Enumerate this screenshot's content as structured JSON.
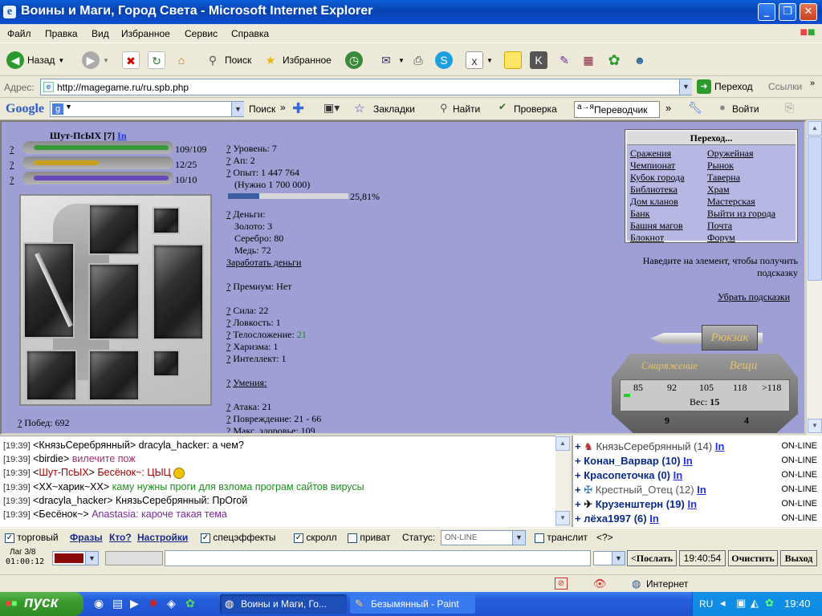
{
  "window": {
    "title": "Воины и Маги, Город Света - Microsoft Internet Explorer",
    "ie_glyph": "e"
  },
  "menu": [
    "Файл",
    "Правка",
    "Вид",
    "Избранное",
    "Сервис",
    "Справка"
  ],
  "toolbar": {
    "back": "Назад",
    "search": "Поиск",
    "favorites": "Избранное"
  },
  "address": {
    "label": "Адрес:",
    "url": "http://magegame.ru/ru.spb.php",
    "go": "Переход",
    "links": "Ссылки"
  },
  "googlebar": {
    "logo": "Google",
    "search": "Поиск",
    "bookmarks": "Закладки",
    "find": "Найти",
    "check": "Проверка",
    "translate": "Переводчик",
    "login": "Войти"
  },
  "character": {
    "name": "Шут-ПсЫХ [7]",
    "info_tag": "In",
    "hp": "109/109",
    "hp_fill": 1.0,
    "mana": "12/25",
    "mana_fill": 0.48,
    "energy": "10/10",
    "energy_fill": 1.0,
    "wins": "Побед: 692",
    "level": "Уровень: 7",
    "ap": "Ап: 2",
    "exp": "Опыт: 1 447 764",
    "exp_need": "(Нужно 1 700 000)",
    "exp_pct": "25,81%",
    "exp_fill": 0.2581,
    "money_label": "Деньги:",
    "gold": "Золото: 3",
    "silver": "Серебро: 80",
    "copper": "Медь: 72",
    "earn": "Заработать деньги",
    "premium": "Премиум: Нет",
    "strength": "Сила: 22",
    "agility": "Ловкость: 1",
    "constitution_label": "Телосложение:",
    "constitution_value": "21",
    "charisma": "Харизма: 1",
    "intellect": "Интеллект: 1",
    "skills": "Умения:",
    "attack": "Атака: 21",
    "damage": "Повреждение: 21 - 66",
    "max_hp": "Макс. здоровье: 109"
  },
  "nav": {
    "title": "Переход...",
    "left": [
      "Сражения",
      "Чемпионат",
      "Кубок города",
      "Библиотека",
      "Дом кланов",
      "Банк",
      "Башня магов",
      "Блокнот"
    ],
    "right": [
      "Оружейная",
      "Рынок",
      "Таверна",
      "Храм",
      "Мастерская",
      "Выйти из города",
      "Почта",
      "Форум"
    ]
  },
  "hint": {
    "text": "Наведите на элемент, чтобы получить подсказку",
    "remove": "Убрать подсказки"
  },
  "backpack": {
    "title": "Рюкзак",
    "tab_gear": "Снаряжение",
    "tab_items": "Вещи",
    "scale": [
      "85",
      "92",
      "105",
      "118",
      ">118"
    ],
    "weight_label": "Вес:",
    "weight_value": "15",
    "count_left": "9",
    "count_right": "4"
  },
  "chat": [
    {
      "time": "[19:39]",
      "nick": "КнязьСеребрянный",
      "text": "dracyla_hacker: а чем?",
      "color": "#000000"
    },
    {
      "time": "[19:39]",
      "nick": "birdie",
      "text": "вилечите пож",
      "color": "#a0306a"
    },
    {
      "time": "[19:39]",
      "nick": "Шут-ПсЫХ",
      "text": "Бесёнок~: ЦЫЦ",
      "color": "#a00000"
    },
    {
      "time": "[19:39]",
      "nick": "XX~харик~XX",
      "text": "каму нужны проги для взлома програм сайтов вирусы",
      "color": "#1b8f1b"
    },
    {
      "time": "[19:39]",
      "nick": "dracyla_hacker",
      "text": "КнязьСеребрянный: ПрОгой",
      "color": "#000000"
    },
    {
      "time": "[19:39]",
      "nick": "Бесёнок~",
      "text": "Anastasia: кароче такая тема",
      "color": "#7a2a9a"
    }
  ],
  "users": [
    {
      "name": "КнязьСеребрянный (14)",
      "status": "ON-LINE",
      "color": "#444444"
    },
    {
      "name": "Конан_Варвар (10)",
      "status": "ON-LINE",
      "color": "#0a2a8a"
    },
    {
      "name": "Красопеточка (0)",
      "status": "ON-LINE",
      "color": "#0a2a8a"
    },
    {
      "name": "Крестный_Отец (12)",
      "status": "ON-LINE",
      "color": "#555555"
    },
    {
      "name": "Крузенштерн (19)",
      "status": "ON-LINE",
      "color": "#0a2a8a"
    },
    {
      "name": "лёха1997 (6)",
      "status": "ON-LINE",
      "color": "#0a2a8a"
    }
  ],
  "users_in": "In",
  "controls": {
    "trade": "торговый",
    "phrases": "Фразы",
    "who": "Кто?",
    "settings": "Настройки",
    "effects": "спецэффекты",
    "scroll": "скролл",
    "private": "приват",
    "status_label": "Статус:",
    "status_value": "ON-LINE",
    "translit": "транслит",
    "help": "<?>"
  },
  "inputbar": {
    "lag": "Лаг 3/8",
    "clock": "01:00:12",
    "send": "<Послать",
    "time": "19:40:54",
    "clear": "Очистить",
    "exit": "Выход"
  },
  "statusbar": {
    "zone": "Интернет"
  },
  "taskbar": {
    "start": "пуск",
    "task1": "Воины и Маги, Го...",
    "task2": "Безымянный - Paint",
    "lang": "RU",
    "time": "19:40"
  },
  "colors": {
    "page_bg": "#9e9fd4",
    "hp": "#3a9a3a",
    "mana": "#c8a020",
    "energy": "#6a4ab8",
    "exp": "#3b5fa0",
    "green_val": "#1e7a1e"
  }
}
